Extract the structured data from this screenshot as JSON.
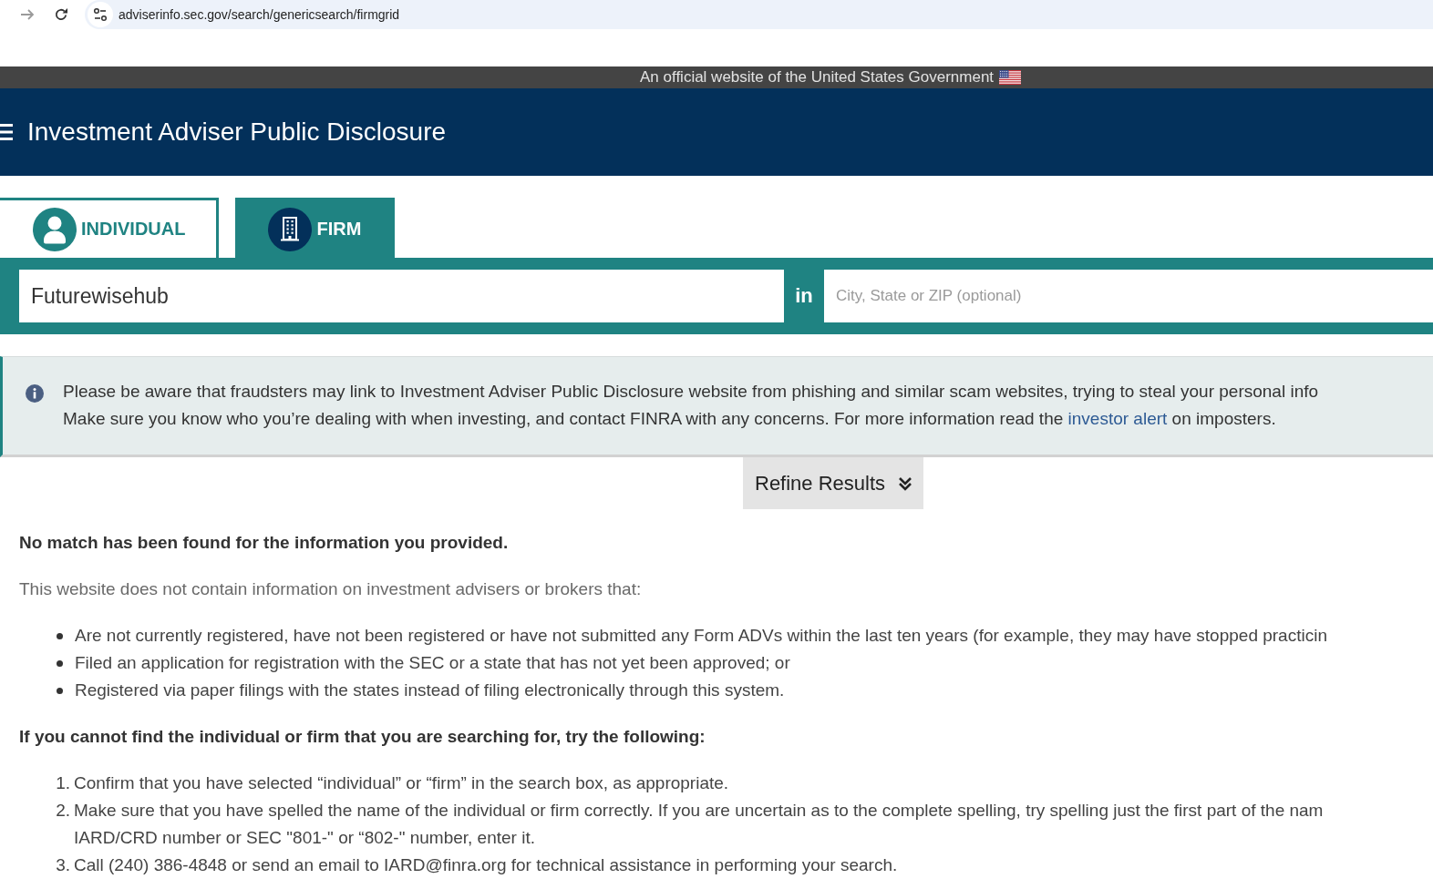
{
  "browser": {
    "url": "adviserinfo.sec.gov/search/genericsearch/firmgrid"
  },
  "gov_banner": {
    "text": "An official website of the United States Government"
  },
  "header": {
    "title": "Investment Adviser Public Disclosure"
  },
  "search": {
    "tabs": [
      {
        "label": "INDIVIDUAL",
        "kind": "individual",
        "selected": false
      },
      {
        "label": "FIRM",
        "kind": "firm",
        "selected": true
      }
    ],
    "name_field": {
      "value": "Futurewisehub"
    },
    "connector": "in",
    "location_field": {
      "placeholder": "City, State or ZIP (optional)"
    }
  },
  "alert": {
    "lines": [
      {
        "text": "Please be aware that fraudsters may link to Investment Adviser Public Disclosure website from phishing and similar scam websites, trying to steal your personal info"
      },
      {
        "text": "Make sure you know who you’re dealing with when investing, and contact FINRA with any concerns. For more information read the ",
        "link": "investor alert",
        "after": " on imposters."
      }
    ]
  },
  "refine_button": {
    "label": "Refine Results",
    "expanded": false
  },
  "results": {
    "no_match": "No match has been found for the information you provided.",
    "intro": "This website does not contain information on investment advisers or brokers that:",
    "reasons": [
      "Are not currently registered, have not been registered or have not submitted any Form ADVs within the last ten years (for example, they may have stopped practicin",
      "Filed an application for registration with the SEC or a state that has not yet been approved; or",
      "Registered via paper filings with the states instead of filing electronically through this system."
    ],
    "help_heading": "If you cannot find the individual or firm that you are searching for, try the following:",
    "steps": [
      {
        "number": "1.",
        "lines": [
          "Confirm that you have selected “individual” or “firm” in the search box, as appropriate."
        ]
      },
      {
        "number": "2.",
        "lines": [
          "Make sure that you have spelled the name of the individual or firm correctly. If you are uncertain as to the complete spelling, try spelling just the first part of the nam",
          "IARD/CRD number or SEC \"801-\" or “802-\" number, enter it."
        ]
      },
      {
        "number": "3.",
        "lines": [
          "Call (240) 386-4848 or send an email to IARD@finra.org for technical assistance in performing your search."
        ]
      }
    ]
  }
}
